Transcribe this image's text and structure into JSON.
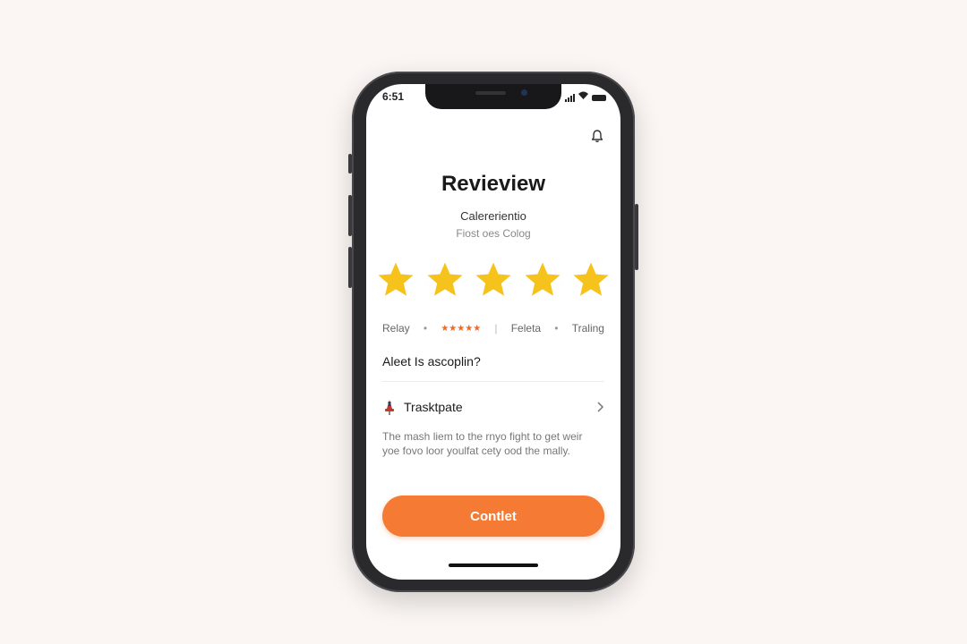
{
  "status_bar": {
    "time": "6:51"
  },
  "header": {
    "title": "Revieview",
    "subtitle": "Calererientio",
    "caption": "Fiost oes Colog"
  },
  "rating": {
    "stars": 5,
    "max": 5,
    "star_color": "#f6c21c"
  },
  "meta": {
    "left": "Relay",
    "middle_stars": "★★★★★",
    "right1": "Feleta",
    "right2": "Traling"
  },
  "question": "Aleet Is ascoplin?",
  "list_item": {
    "label": "Trasktpate"
  },
  "body_text": "The mash liem to the rnyo fight to get weir yoe fovo loor youlfat cety ood the mally.",
  "cta": {
    "label": "Contlet",
    "color": "#f57a34"
  },
  "colors": {
    "background": "#fbf6f3",
    "phone_frame": "#2a2a2d",
    "accent": "#f57a34"
  },
  "icons": [
    "bell-icon",
    "signal-icon",
    "wifi-icon",
    "battery-icon",
    "star-icon",
    "pin-icon",
    "chevron-right-icon"
  ]
}
